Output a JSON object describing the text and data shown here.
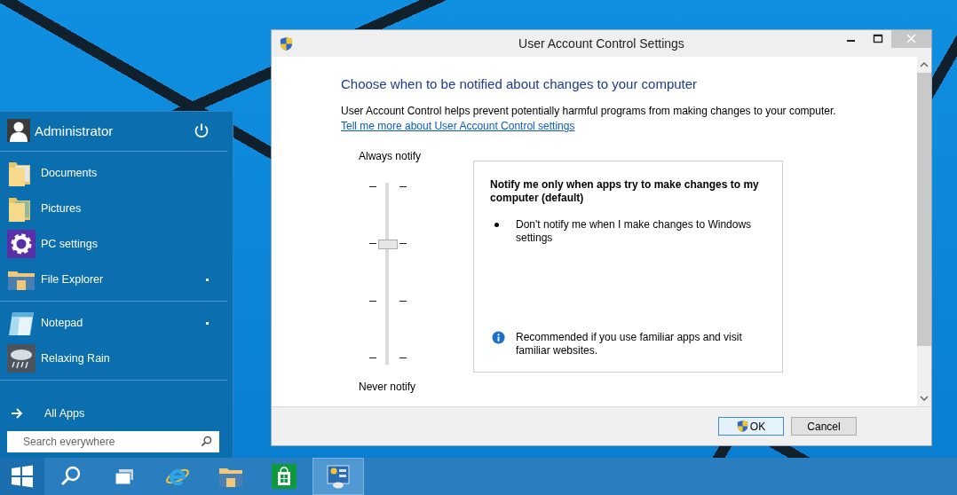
{
  "start_menu": {
    "user": "Administrator",
    "groups": [
      [
        {
          "label": "Documents",
          "kind": "documents",
          "submenu": false
        },
        {
          "label": "Pictures",
          "kind": "pictures",
          "submenu": false
        },
        {
          "label": "PC settings",
          "kind": "settings",
          "submenu": false
        },
        {
          "label": "File Explorer",
          "kind": "explorer",
          "submenu": true
        }
      ],
      [
        {
          "label": "Notepad",
          "kind": "notepad",
          "submenu": true
        },
        {
          "label": "Relaxing Rain",
          "kind": "rain",
          "submenu": false
        }
      ]
    ],
    "all_apps": "All Apps",
    "search": {
      "placeholder": "Search everywhere"
    }
  },
  "taskbar": {
    "items": [
      {
        "kind": "start",
        "selected": false
      },
      {
        "kind": "search",
        "selected": false
      },
      {
        "kind": "task-view",
        "selected": false
      },
      {
        "kind": "browser",
        "selected": false
      },
      {
        "kind": "explorer",
        "selected": false
      },
      {
        "kind": "store",
        "selected": false
      },
      {
        "kind": "control-panel",
        "selected": true
      }
    ]
  },
  "window": {
    "title": "User Account Control Settings",
    "heading": "Choose when to be notified about changes to your computer",
    "description": "User Account Control helps prevent potentially harmful programs from making changes to your computer.",
    "link": "Tell me more about User Account Control settings",
    "slider": {
      "top_label": "Always notify",
      "bottom_label": "Never notify",
      "level": 0.67
    },
    "panel": {
      "title": "Notify me only when apps try to make changes to my computer (default)",
      "bullets": [
        "Don't notify me when I make changes to Windows settings"
      ],
      "note": "Recommended if you use familiar apps and visit familiar websites."
    },
    "buttons": [
      {
        "label": "OK",
        "kind": "elevated",
        "default": true
      },
      {
        "label": "Cancel",
        "kind": "plain",
        "default": false
      }
    ]
  }
}
